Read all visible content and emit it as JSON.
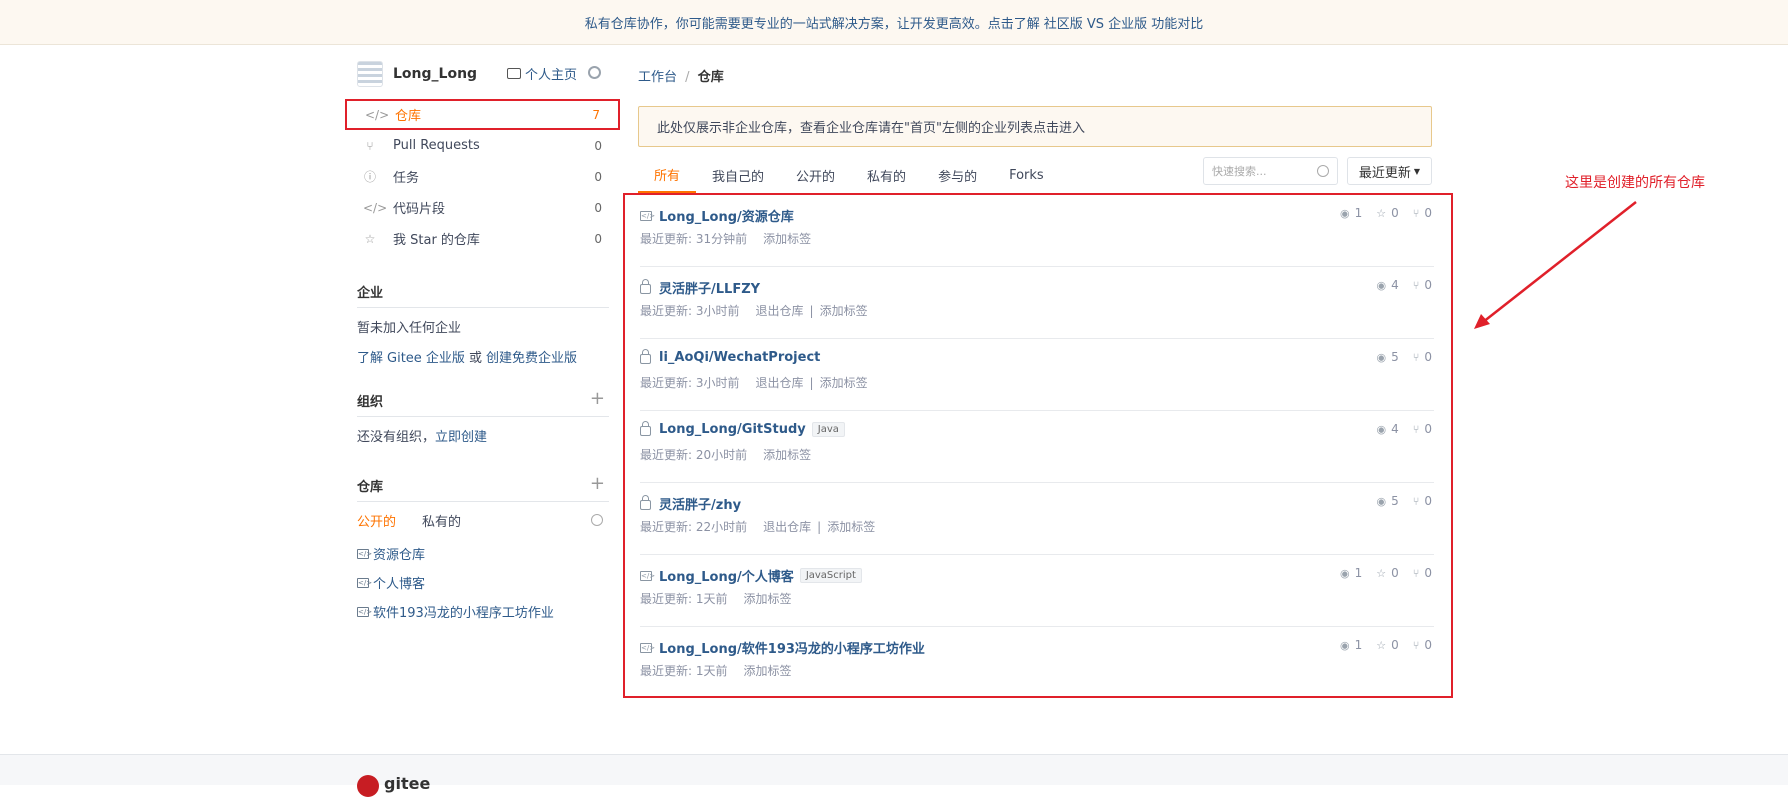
{
  "banner": {
    "text1": "私有仓库协作，你可能需要更专业的一站式解决方案，让开发更高效。点击了解",
    "link1": "社区版 VS 企业版 功能对比"
  },
  "user": {
    "name": "Long_Long",
    "home_label": "个人主页"
  },
  "nav": [
    {
      "icon": "repo-icon",
      "label": "仓库",
      "count": "7"
    },
    {
      "icon": "pull-request-icon",
      "label": "Pull Requests",
      "count": "0"
    },
    {
      "icon": "issue-icon",
      "label": "任务",
      "count": "0"
    },
    {
      "icon": "code-icon",
      "label": "代码片段",
      "count": "0"
    },
    {
      "icon": "star-icon",
      "label": "我 Star 的仓库",
      "count": "0"
    }
  ],
  "enterprise": {
    "title": "企业",
    "none": "暂未加入任何企业",
    "learn_prefix": "了解",
    "learn_link": "Gitee 企业版",
    "or": "或",
    "create_link": "创建免费企业版"
  },
  "org": {
    "title": "组织",
    "none_prefix": "还没有组织，",
    "create_link": "立即创建"
  },
  "repos_side": {
    "title": "仓库",
    "tab_public": "公开的",
    "tab_private": "私有的",
    "items": [
      "资源仓库",
      "个人博客",
      "软件193冯龙的小程序工坊作业"
    ]
  },
  "breadcrumb": {
    "root": "工作台",
    "sep": "/",
    "current": "仓库"
  },
  "notice": "此处仅展示非企业仓库，查看企业仓库请在\"首页\"左侧的企业列表点击进入",
  "tabs": [
    "所有",
    "我自己的",
    "公开的",
    "私有的",
    "参与的",
    "Forks"
  ],
  "search_placeholder": "快速搜索...",
  "sort_label": "最近更新",
  "repos": [
    {
      "name": "Long_Long/资源仓库",
      "private": false,
      "lang": "",
      "updated": "最近更新: 31分钟前",
      "quit": "",
      "tag": "添加标签",
      "watch": "1",
      "star": "0",
      "fork": "0"
    },
    {
      "name": "灵活胖子/LLFZY",
      "private": true,
      "lang": "",
      "updated": "最近更新: 3小时前",
      "quit": "退出仓库",
      "tag": "添加标签",
      "watch": "4",
      "star": "",
      "fork": "0"
    },
    {
      "name": "li_AoQi/WechatProject",
      "private": true,
      "lang": "",
      "updated": "最近更新: 3小时前",
      "quit": "退出仓库",
      "tag": "添加标签",
      "watch": "5",
      "star": "",
      "fork": "0"
    },
    {
      "name": "Long_Long/GitStudy",
      "private": true,
      "lang": "Java",
      "updated": "最近更新: 20小时前",
      "quit": "",
      "tag": "添加标签",
      "watch": "4",
      "star": "",
      "fork": "0"
    },
    {
      "name": "灵活胖子/zhy",
      "private": true,
      "lang": "",
      "updated": "最近更新: 22小时前",
      "quit": "退出仓库",
      "tag": "添加标签",
      "watch": "5",
      "star": "",
      "fork": "0"
    },
    {
      "name": "Long_Long/个人博客",
      "private": false,
      "lang": "JavaScript",
      "updated": "最近更新: 1天前",
      "quit": "",
      "tag": "添加标签",
      "watch": "1",
      "star": "0",
      "fork": "0"
    },
    {
      "name": "Long_Long/软件193冯龙的小程序工坊作业",
      "private": false,
      "lang": "",
      "updated": "最近更新: 1天前",
      "quit": "",
      "tag": "添加标签",
      "watch": "1",
      "star": "0",
      "fork": "0"
    }
  ],
  "annotation": "这里是创建的所有仓库",
  "footer": {
    "brand": "gitee"
  },
  "colors": {
    "accent": "#fe7300",
    "annotation_red": "#e0202a",
    "link": "#2e5a8a"
  }
}
